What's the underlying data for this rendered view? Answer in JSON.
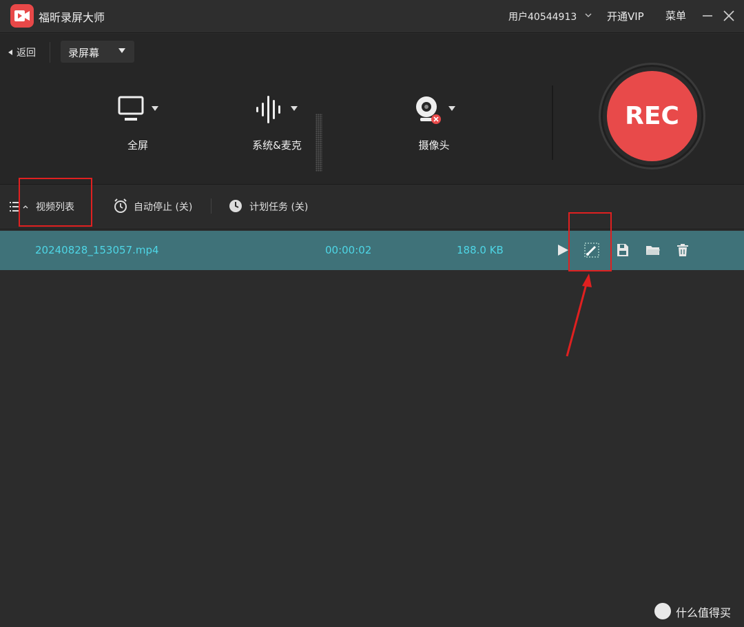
{
  "titlebar": {
    "app_title": "福昕录屏大师",
    "user": "用户40544913",
    "vip": "开通VIP",
    "menu": "菜单"
  },
  "panel": {
    "back_label": "返回",
    "mode_label": "录屏幕",
    "sources": [
      {
        "label": "全屏",
        "icon": "monitor-icon"
      },
      {
        "label": "系统&麦克",
        "icon": "audio-wave-icon"
      },
      {
        "label": "摄像头",
        "icon": "webcam-icon"
      }
    ],
    "rec_label": "REC"
  },
  "toolbar": {
    "video_list": "视频列表",
    "auto_stop": "自动停止 (关)",
    "schedule": "计划任务 (关)"
  },
  "files": [
    {
      "name": "20240828_153057.mp4",
      "duration": "00:00:02",
      "size": "188.0 KB"
    }
  ],
  "row_actions": [
    "play-icon",
    "edit-icon",
    "save-icon",
    "folder-icon",
    "trash-icon"
  ],
  "watermark": "什么值得买",
  "colors": {
    "accent_red": "#e84a4a",
    "row_bg": "#3f7279",
    "row_text": "#4ed6e6",
    "highlight": "#e02020"
  }
}
